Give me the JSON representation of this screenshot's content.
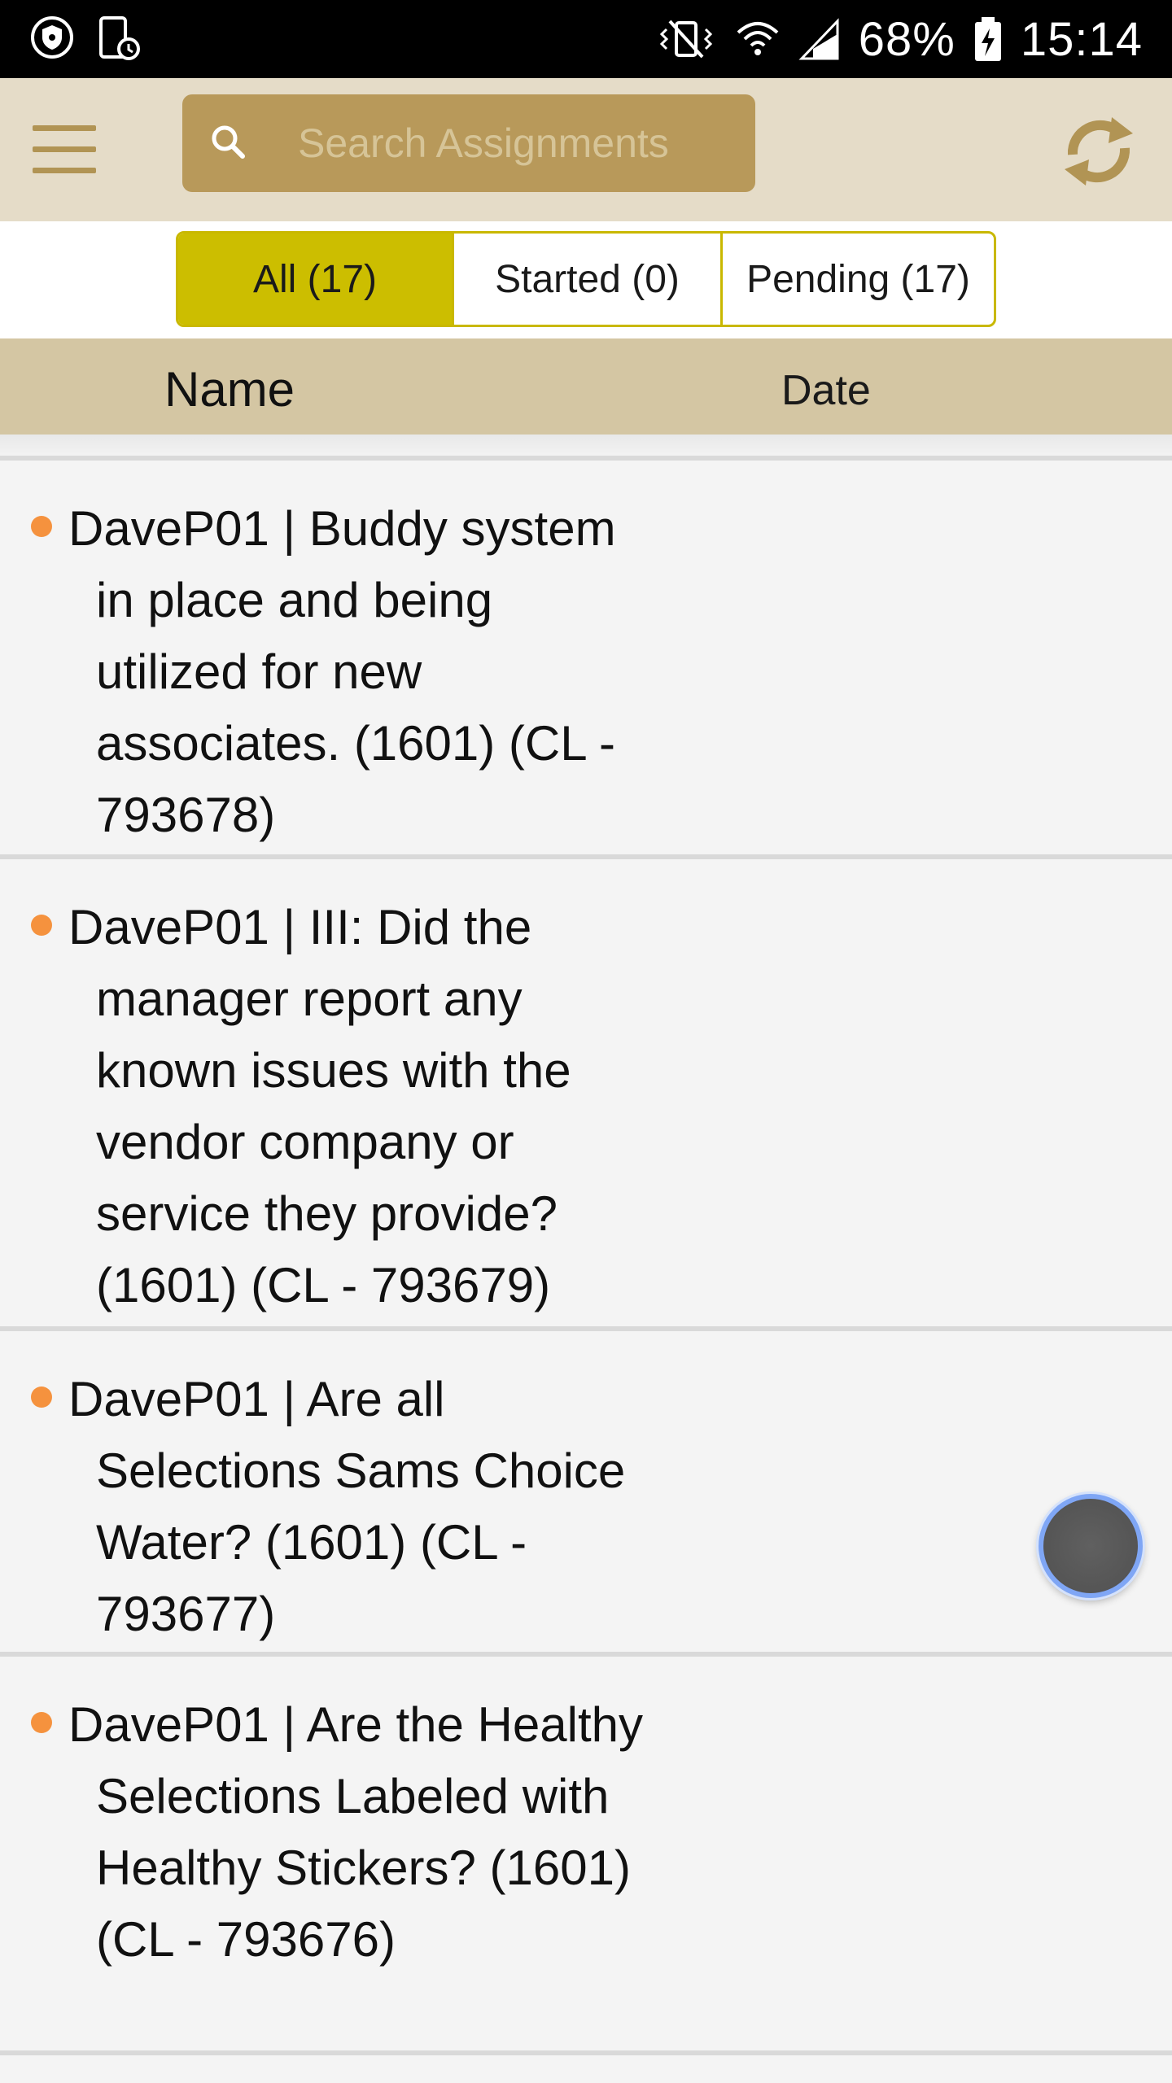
{
  "status_bar": {
    "battery": "68%",
    "time": "15:14",
    "icons": [
      "shield-icon",
      "phone-sync-icon",
      "vibrate-icon",
      "wifi-icon",
      "signal-icon",
      "battery-charging-icon"
    ]
  },
  "header": {
    "menu_icon": "hamburger-menu-icon",
    "search": {
      "placeholder": "Search Assignments",
      "value": ""
    },
    "sync_icon": "sync-icon",
    "colors": {
      "bar": "#e5dcc8",
      "search_bg": "#b8995a",
      "accent": "#b19454"
    }
  },
  "filters": {
    "selected": "all",
    "tabs": [
      {
        "id": "all",
        "label": "All (17)"
      },
      {
        "id": "started",
        "label": "Started (0)"
      },
      {
        "id": "pending",
        "label": "Pending (17)"
      }
    ],
    "colors": {
      "selected_bg": "#ccbe00",
      "border": "#c9b800"
    }
  },
  "columns": {
    "name": "Name",
    "date": "Date"
  },
  "assignments": [
    {
      "text": "DaveP01 | Buddy system in place and being utilized for new associates. (1601) (CL - 793678)",
      "status_color": "#f5923e"
    },
    {
      "text": "DaveP01 | III: Did the manager report any known issues with the vendor company or service they provide? (1601) (CL - 793679)",
      "status_color": "#f5923e"
    },
    {
      "text": "DaveP01 | Are all Selections Sams Choice Water? (1601) (CL - 793677)",
      "status_color": "#f5923e"
    },
    {
      "text": "DaveP01 | Are the Healthy Selections Labeled with Healthy Stickers? (1601) (CL - 793676)",
      "status_color": "#f5923e"
    }
  ]
}
